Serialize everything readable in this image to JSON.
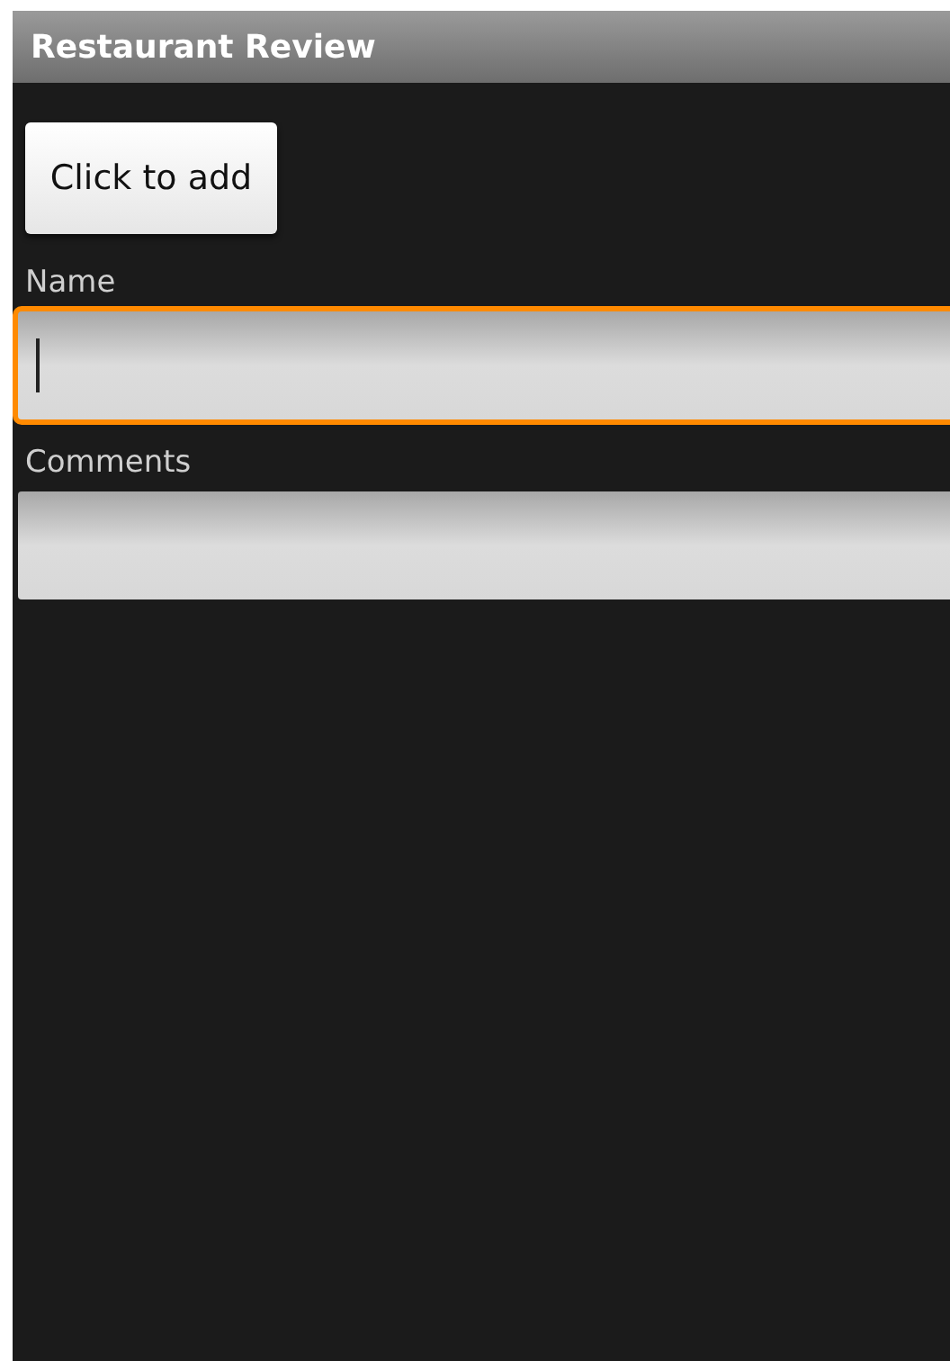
{
  "window": {
    "title": "Restaurant Review"
  },
  "add_button": {
    "label": "Click to add"
  },
  "fields": [
    {
      "label": "Name",
      "focused": true
    },
    {
      "label": "Comments",
      "focused": false
    }
  ]
}
